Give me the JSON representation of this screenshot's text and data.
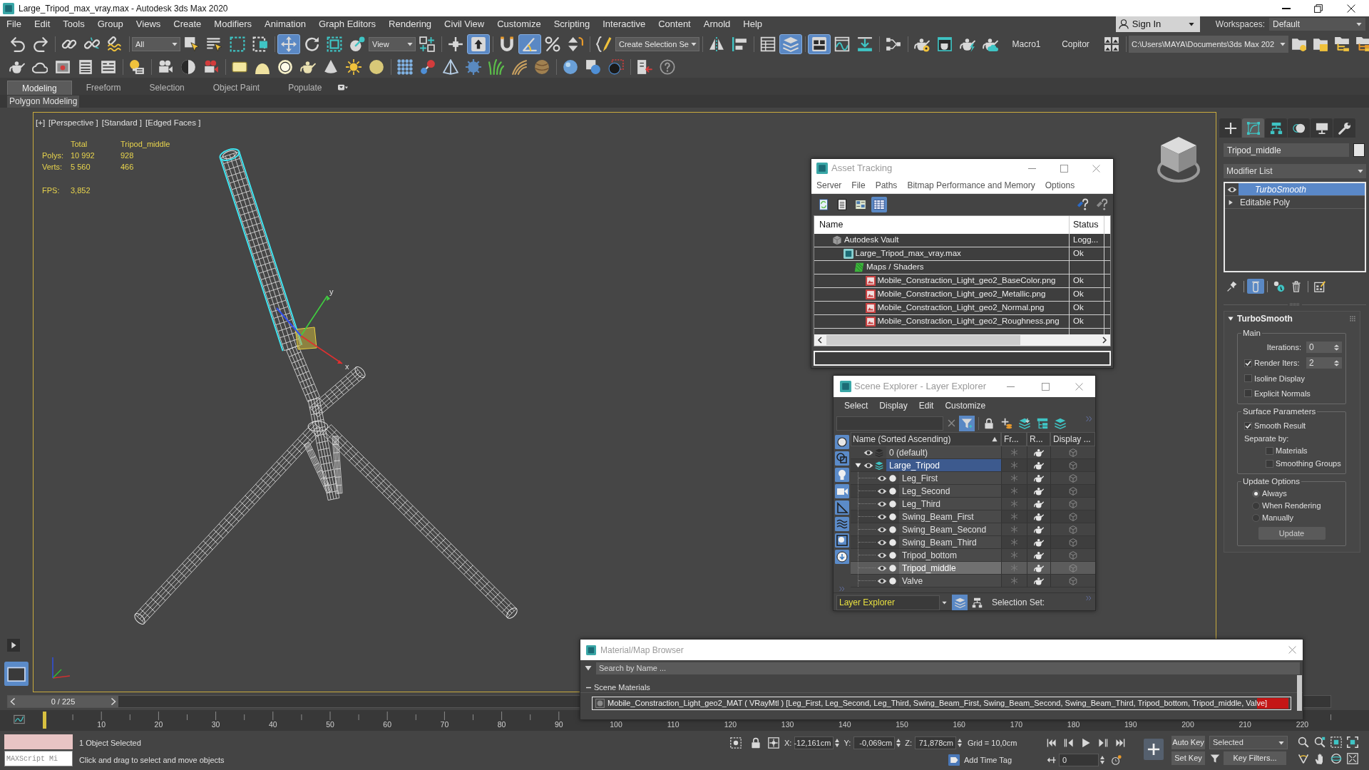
{
  "window": {
    "title": "Large_Tripod_max_vray.max - Autodesk 3ds Max 2020"
  },
  "menu_bar": {
    "items": [
      "File",
      "Edit",
      "Tools",
      "Group",
      "Views",
      "Create",
      "Modifiers",
      "Animation",
      "Graph Editors",
      "Rendering",
      "Civil View",
      "Customize",
      "Scripting",
      "Interactive",
      "Content",
      "Arnold",
      "Help"
    ],
    "sign_in": "Sign In",
    "workspaces_label": "Workspaces:",
    "workspace": "Default"
  },
  "main_toolbar": [
    [
      {
        "kind": "button",
        "selected": false
      },
      {
        "kind": "button",
        "selected": false
      }
    ],
    [
      {
        "kind": "button",
        "selected": false
      },
      {
        "kind": "button",
        "selected": false
      },
      {
        "kind": "button",
        "selected": false
      }
    ],
    [
      {
        "kind": "dropdown",
        "value": "All"
      },
      {
        "kind": "button",
        "selected": false
      },
      {
        "kind": "button",
        "selected": false
      },
      {
        "kind": "button",
        "selected": false
      },
      {
        "kind": "button",
        "selected": false
      }
    ],
    [
      {
        "kind": "button",
        "selected": true
      },
      {
        "kind": "button",
        "selected": false
      },
      {
        "kind": "button",
        "selected": false
      },
      {
        "kind": "button",
        "selected": false
      },
      {
        "kind": "dropdown",
        "value": "View"
      },
      {
        "kind": "button",
        "selected": false
      }
    ],
    [
      {
        "kind": "button",
        "selected": false
      },
      {
        "kind": "button",
        "selected": true
      }
    ],
    [
      {
        "kind": "button",
        "selected": false
      },
      {
        "kind": "button",
        "selected": true
      },
      {
        "kind": "button",
        "selected": false
      },
      {
        "kind": "button",
        "selected": false
      }
    ],
    [
      {
        "kind": "button",
        "selected": false
      },
      {
        "kind": "dropdown",
        "value": "Create Selection Se"
      }
    ],
    [
      {
        "kind": "button",
        "selected": false
      },
      {
        "kind": "button",
        "selected": false
      }
    ],
    [
      {
        "kind": "button",
        "selected": false
      },
      {
        "kind": "button",
        "selected": true
      }
    ],
    [
      {
        "kind": "button",
        "selected": true
      },
      {
        "kind": "button",
        "selected": false
      },
      {
        "kind": "button",
        "selected": false
      }
    ],
    [
      {
        "kind": "button",
        "selected": false
      }
    ],
    [
      {
        "kind": "button",
        "selected": false
      },
      {
        "kind": "button",
        "selected": false
      },
      {
        "kind": "button",
        "selected": false
      },
      {
        "kind": "button",
        "selected": false
      },
      {
        "kind": "label",
        "text": "Macro1"
      },
      {
        "kind": "label",
        "text": "Copitor"
      },
      {
        "kind": "button",
        "selected": false
      }
    ],
    [
      {
        "kind": "path",
        "value": "C:\\Users\\MAYA\\Documents\\3ds Max 202"
      },
      {
        "kind": "button",
        "selected": false
      },
      {
        "kind": "button",
        "selected": false
      },
      {
        "kind": "button",
        "selected": false
      },
      {
        "kind": "button",
        "selected": false
      }
    ]
  ],
  "ribbon": {
    "tabs": [
      {
        "label": "Modeling",
        "selected": true
      },
      {
        "label": "Freeform",
        "selected": false
      },
      {
        "label": "Selection",
        "selected": false
      },
      {
        "label": "Object Paint",
        "selected": false
      },
      {
        "label": "Populate",
        "selected": false
      }
    ],
    "panel": "Polygon Modeling"
  },
  "viewport": {
    "labels": [
      "[+]",
      "[Perspective ]",
      "[Standard ]",
      "[Edged Faces ]"
    ],
    "stats_columns": [
      "Total",
      "Tripod_middle"
    ],
    "stats": [
      {
        "label": "Polys:",
        "values": [
          "10 992",
          "928"
        ]
      },
      {
        "label": "Verts:",
        "values": [
          "5 560",
          "466"
        ]
      }
    ],
    "fps_label": "FPS:",
    "fps": "3,852",
    "gizmo_labels": [
      "y",
      "x"
    ]
  },
  "command_panel": {
    "tabs": [
      {
        "selected": false
      },
      {
        "selected": true
      },
      {
        "selected": false
      },
      {
        "selected": false
      },
      {
        "selected": false
      },
      {
        "selected": false
      }
    ],
    "object_name": "Tripod_middle",
    "modifier_list": "Modifier List",
    "stack": [
      {
        "kind": "modifier",
        "name": "TurboSmooth",
        "selected": true,
        "expanded": false
      },
      {
        "kind": "base",
        "name": "Editable Poly",
        "selected": false,
        "expanded": false
      }
    ],
    "stack_tools": [
      {
        "selected": false
      },
      {
        "selected": true
      },
      {
        "selected": false
      },
      {
        "selected": false
      },
      {
        "selected": false
      }
    ],
    "rollout": {
      "title": "TurboSmooth",
      "expanded": true,
      "groups": [
        {
          "title": "Main",
          "controls": [
            {
              "kind": "spinner",
              "label": "Iterations:",
              "value": "0"
            },
            {
              "kind": "checkspinner",
              "label": "Render Iters:",
              "checked": true,
              "value": "2"
            },
            {
              "kind": "checkbox",
              "label": "Isoline Display",
              "checked": false
            },
            {
              "kind": "checkbox",
              "label": "Explicit Normals",
              "checked": false
            }
          ]
        },
        {
          "title": "Surface Parameters",
          "controls": [
            {
              "kind": "checkbox",
              "label": "Smooth Result",
              "checked": true
            },
            {
              "kind": "text",
              "label": "Separate by:"
            },
            {
              "kind": "subcheckbox",
              "label": "Materials",
              "checked": false
            },
            {
              "kind": "subcheckbox",
              "label": "Smoothing Groups",
              "checked": false
            }
          ]
        },
        {
          "title": "Update Options",
          "controls": [
            {
              "kind": "radio",
              "label": "Always",
              "selected": true
            },
            {
              "kind": "radio",
              "label": "When Rendering",
              "selected": false
            },
            {
              "kind": "radio",
              "label": "Manually",
              "selected": false
            },
            {
              "kind": "button",
              "label": "Update"
            }
          ]
        }
      ]
    }
  },
  "asset_tracking": {
    "title": "Asset Tracking",
    "menu": [
      "Server",
      "File",
      "Paths",
      "Bitmap Performance and Memory",
      "Options"
    ],
    "toolbar": [
      {
        "selected": false
      },
      {
        "selected": false
      },
      {
        "selected": false
      },
      {
        "selected": true
      }
    ],
    "columns": [
      "Name",
      "Status"
    ],
    "tree": [
      {
        "kind": "vault",
        "name": "Autodesk Vault",
        "status": "Logg...",
        "children": [
          {
            "kind": "scene",
            "name": "Large_Tripod_max_vray.max",
            "status": "Ok",
            "children": [
              {
                "kind": "folder",
                "name": "Maps / Shaders",
                "children": [
                  {
                    "kind": "bitmap",
                    "name": "Mobile_Constraction_Light_geo2_BaseColor.png",
                    "status": "Ok"
                  },
                  {
                    "kind": "bitmap",
                    "name": "Mobile_Constraction_Light_geo2_Metallic.png",
                    "status": "Ok"
                  },
                  {
                    "kind": "bitmap",
                    "name": "Mobile_Constraction_Light_geo2_Normal.png",
                    "status": "Ok"
                  },
                  {
                    "kind": "bitmap",
                    "name": "Mobile_Constraction_Light_geo2_Roughness.png",
                    "status": "Ok"
                  }
                ]
              }
            ]
          }
        ]
      }
    ]
  },
  "scene_explorer": {
    "title": "Scene Explorer - Layer Explorer",
    "menu": [
      "Select",
      "Display",
      "Edit",
      "Customize"
    ],
    "toolbar": [
      {
        "selected": true
      },
      {
        "selected": false
      },
      {
        "selected": false
      },
      {
        "selected": false
      },
      {
        "selected": false
      },
      {
        "selected": false
      }
    ],
    "display_filters": [
      {
        "selected": true
      },
      {
        "selected": true
      },
      {
        "selected": true
      },
      {
        "selected": true
      },
      {
        "selected": true
      },
      {
        "selected": true
      },
      {
        "selected": true
      },
      {
        "selected": true
      }
    ],
    "columns": [
      "Name (Sorted Ascending)",
      "Fr...",
      "R...",
      "Display ..."
    ],
    "layers": [
      {
        "name": "0 (default)",
        "selected": false,
        "current": false,
        "expanded": false
      },
      {
        "name": "Large_Tripod",
        "selected": true,
        "current": true,
        "expanded": true,
        "children": [
          {
            "name": "Leg_First",
            "selected": false
          },
          {
            "name": "Leg_Second",
            "selected": false
          },
          {
            "name": "Leg_Third",
            "selected": false
          },
          {
            "name": "Swing_Beam_First",
            "selected": false
          },
          {
            "name": "Swing_Beam_Second",
            "selected": false
          },
          {
            "name": "Swing_Beam_Third",
            "selected": false
          },
          {
            "name": "Tripod_bottom",
            "selected": false
          },
          {
            "name": "Tripod_middle",
            "selected": true
          },
          {
            "name": "Valve",
            "selected": false
          }
        ]
      }
    ],
    "footer": {
      "explorer": "Layer Explorer",
      "modes": [
        {
          "selected": true
        },
        {
          "selected": false
        }
      ],
      "selection_set_label": "Selection Set:"
    }
  },
  "material_browser": {
    "title": "Material/Map Browser",
    "search": {
      "placeholder": "Search by Name ..."
    },
    "groups": [
      {
        "title": "Scene Materials",
        "expanded": true,
        "items": [
          {
            "name": "Mobile_Constraction_Light_geo2_MAT ( VRayMtl ) [Leg_First, Leg_Second, Leg_Third, Swing_Beam_First, Swing_Beam_Second, Swing_Beam_Third, Tripod_bottom, Tripod_middle, Valve]",
            "selected": true
          }
        ]
      }
    ]
  },
  "time_slider": {
    "frame": "0 / 225",
    "level": 0
  },
  "track_bar": {
    "ticks": [
      "10",
      "20",
      "30",
      "40",
      "50",
      "60",
      "70",
      "80",
      "90",
      "100",
      "110",
      "120",
      "130",
      "140",
      "150",
      "160",
      "170",
      "180",
      "190",
      "200",
      "210",
      "220"
    ]
  },
  "status_bar": {
    "listener": {
      "placeholder": "MAXScript Mi"
    },
    "selection": "1 Object Selected",
    "prompt": "Click and drag to select and move objects",
    "coordinates": [
      {
        "axis": "X:",
        "value": "-12,161cm"
      },
      {
        "axis": "Y:",
        "value": "-0,069cm"
      },
      {
        "axis": "Z:",
        "value": "71,878cm"
      }
    ],
    "grid": "Grid = 10,0cm",
    "time_tag": "Add Time Tag",
    "current_frame": "0",
    "auto_key": "Auto Key",
    "key_mode": "Selected",
    "set_key": "Set Key",
    "key_filters": "Key Filters..."
  }
}
